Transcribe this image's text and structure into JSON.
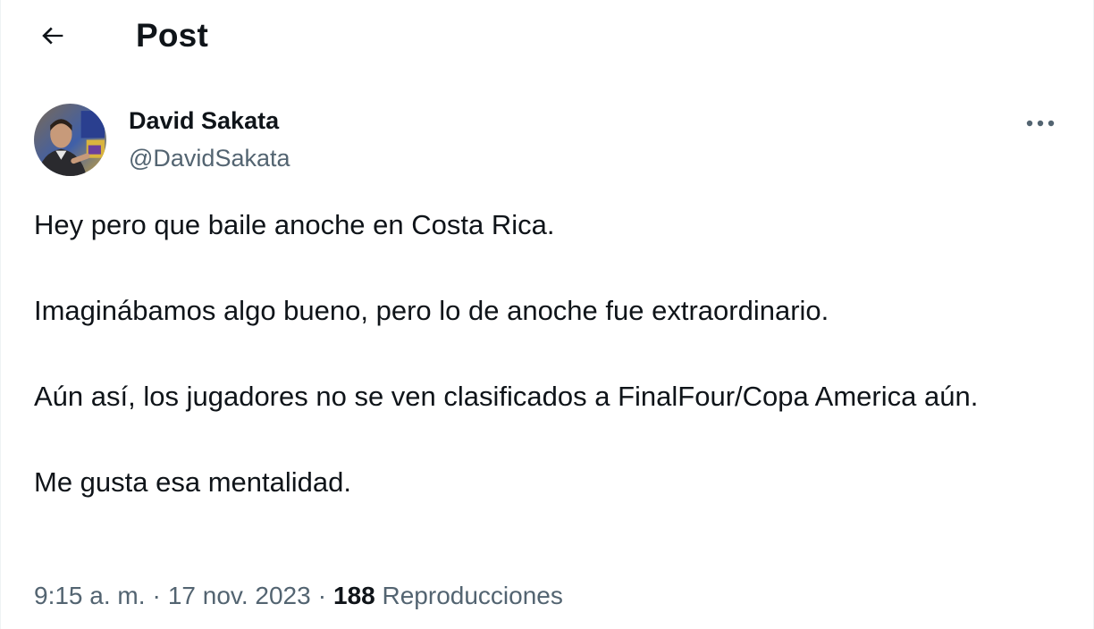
{
  "header": {
    "back_icon": "arrow-left-icon",
    "title": "Post"
  },
  "author": {
    "name": "David Sakata",
    "handle": "@DavidSakata"
  },
  "tweet": {
    "paragraphs": [
      "Hey pero que baile anoche en Costa Rica.",
      "Imaginábamos algo bueno, pero lo de anoche fue extraordinario.",
      "Aún así, los jugadores no se ven clasificados a FinalFour/Copa America aún.",
      "Me gusta esa mentalidad."
    ]
  },
  "meta": {
    "time": "9:15 a. m.",
    "separator": "·",
    "date": "17 nov. 2023",
    "views_count": "188",
    "views_label": "Reproducciones"
  },
  "colors": {
    "text_primary": "#0f1419",
    "text_secondary": "#536471",
    "background": "#ffffff"
  }
}
